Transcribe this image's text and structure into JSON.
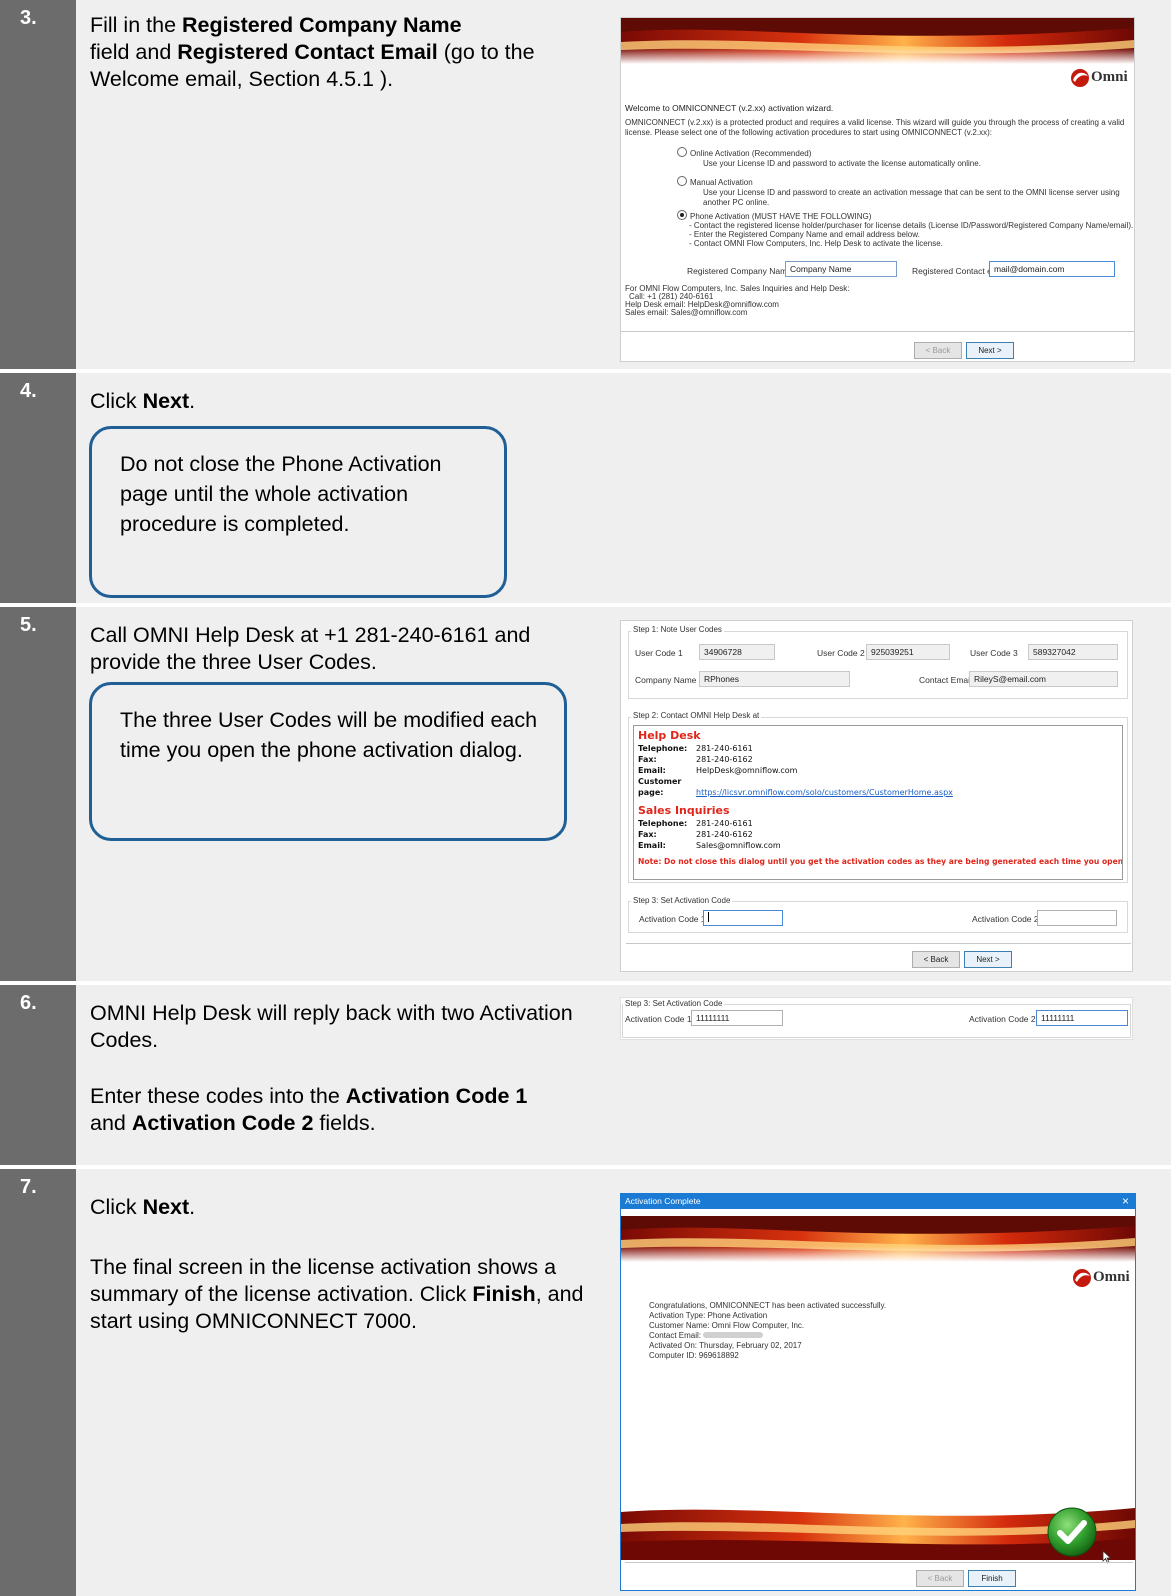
{
  "steps": [
    {
      "number": "3.",
      "text_parts": [
        "Fill in the ",
        "Registered Company Name",
        " field and ",
        "Registered Contact Email",
        " (go to the Welcome email, Section 4.5.1 )."
      ]
    },
    {
      "number": "4.",
      "text_parts": [
        "Click ",
        "Next",
        "."
      ],
      "note": "Do not close the Phone Activation page until the whole activation procedure is completed."
    },
    {
      "number": "5.",
      "text": "Call OMNI Help Desk at +1 281-240-6161 and provide the three User Codes.",
      "note": "The three User Codes will be modified each time you open the phone activation dialog."
    },
    {
      "number": "6.",
      "text": "OMNI Help Desk will reply back with two Activation Codes.",
      "text2_parts": [
        "Enter these codes into the ",
        "Activation Code 1",
        " and ",
        "Activation Code 2",
        " fields."
      ]
    },
    {
      "number": "7.",
      "text_parts": [
        "Click ",
        "Next",
        "."
      ],
      "text2_parts": [
        "The final screen in the license activation shows a summary of the license activation. Click ",
        "Finish",
        ", and start using OMNICONNECT 7000."
      ]
    }
  ],
  "wizard": {
    "logo": "Omni",
    "welcome": "Welcome to OMNICONNECT (v.2.xx) activation wizard.",
    "intro": "OMNICONNECT (v.2.xx) is a protected product and requires a valid license. This wizard will guide you through the process of creating a valid license. Please select one of the following activation procedures to start using OMNICONNECT (v.2.xx):",
    "option1_label": "Online Activation (Recommended)",
    "option1_desc": "Use your License ID and password to activate the license automatically online.",
    "option2_label": "Manual Activation",
    "option2_desc": "Use your License ID and password to create an activation message that can be sent to the OMNI license server using another PC online.",
    "option3_label": "Phone Activation (MUST HAVE THE FOLLOWING)",
    "option3_desc1": "- Contact the registered license holder/purchaser for license details (License ID/Password/Registered Company Name/email).",
    "option3_desc2": "- Enter the Registered Company Name and email address below.",
    "option3_desc3": "- Contact OMNI Flow Computers, Inc. Help Desk to activate the license.",
    "company_label": "Registered Company Name",
    "company_value": "Company Name",
    "email_label": "Registered Contact email",
    "email_value": "mail@domain.com",
    "contact1": "For OMNI Flow Computers, Inc. Sales Inquiries and Help Desk:",
    "contact2": "Call: +1 (281) 240-6161",
    "contact3": "Help Desk email: HelpDesk@omniflow.com",
    "contact4": "Sales email: Sales@omniflow.com",
    "back": "< Back",
    "next": "Next >"
  },
  "phone": {
    "step1_title": "Step 1: Note User Codes",
    "uc1_label": "User Code 1",
    "uc1": "34906728",
    "uc2_label": "User Code 2",
    "uc2": "925039251",
    "uc3_label": "User Code 3",
    "uc3": "589327042",
    "company_label": "Company Name",
    "company": "RPhones",
    "email_label": "Contact Email",
    "email": "RileyS@email.com",
    "step2_title": "Step 2: Contact OMNI Help Desk at",
    "helpdesk_title": "Help Desk",
    "tel_label": "Telephone:",
    "tel": "281-240-6161",
    "fax_label": "Fax:",
    "fax": "281-240-6162",
    "email2_label": "Email:",
    "email2": "HelpDesk@omniflow.com",
    "cust_label": "Customer page:",
    "cust": "https://licsvr.omniflow.com/solo/customers/CustomerHome.aspx",
    "sales_title": "Sales Inquiries",
    "stel_label": "Telephone:",
    "stel": "281-240-6161",
    "sfax_label": "Fax:",
    "sfax": "281-240-6162",
    "semail_label": "Email:",
    "semail": "Sales@omniflow.com",
    "warning": "Note: Do not close this dialog until you get the activation codes as they are being generated each time you open this dialog.",
    "step3_title": "Step 3: Set Activation Code",
    "ac1_label": "Activation Code 1",
    "ac2_label": "Activation Code 2",
    "back": "< Back",
    "next": "Next >"
  },
  "codes": {
    "step3_title": "Step 3: Set Activation Code",
    "ac1_label": "Activation Code 1",
    "ac1": "11111111",
    "ac2_label": "Activation Code 2",
    "ac2": "11111111"
  },
  "complete": {
    "title": "Activation Complete",
    "close": "×",
    "logo": "Omni",
    "line1": "Congratulations, OMNICONNECT has been activated successfully.",
    "line2": "Activation Type: Phone Activation",
    "line3": "Customer Name: Omni Flow Computer, Inc.",
    "line4": "Contact Email:",
    "line5": "Activated On: Thursday, February 02, 2017",
    "line6": "Computer ID: 969618892",
    "back": "< Back",
    "finish": "Finish"
  },
  "colors": {
    "step_bar": "#6c6c6c",
    "row_bg": "#efefef",
    "note_border": "#1f5f96",
    "titlebar": "#1a7ad4",
    "banner_red": "#c0180f",
    "warning_red": "#e0261b"
  }
}
